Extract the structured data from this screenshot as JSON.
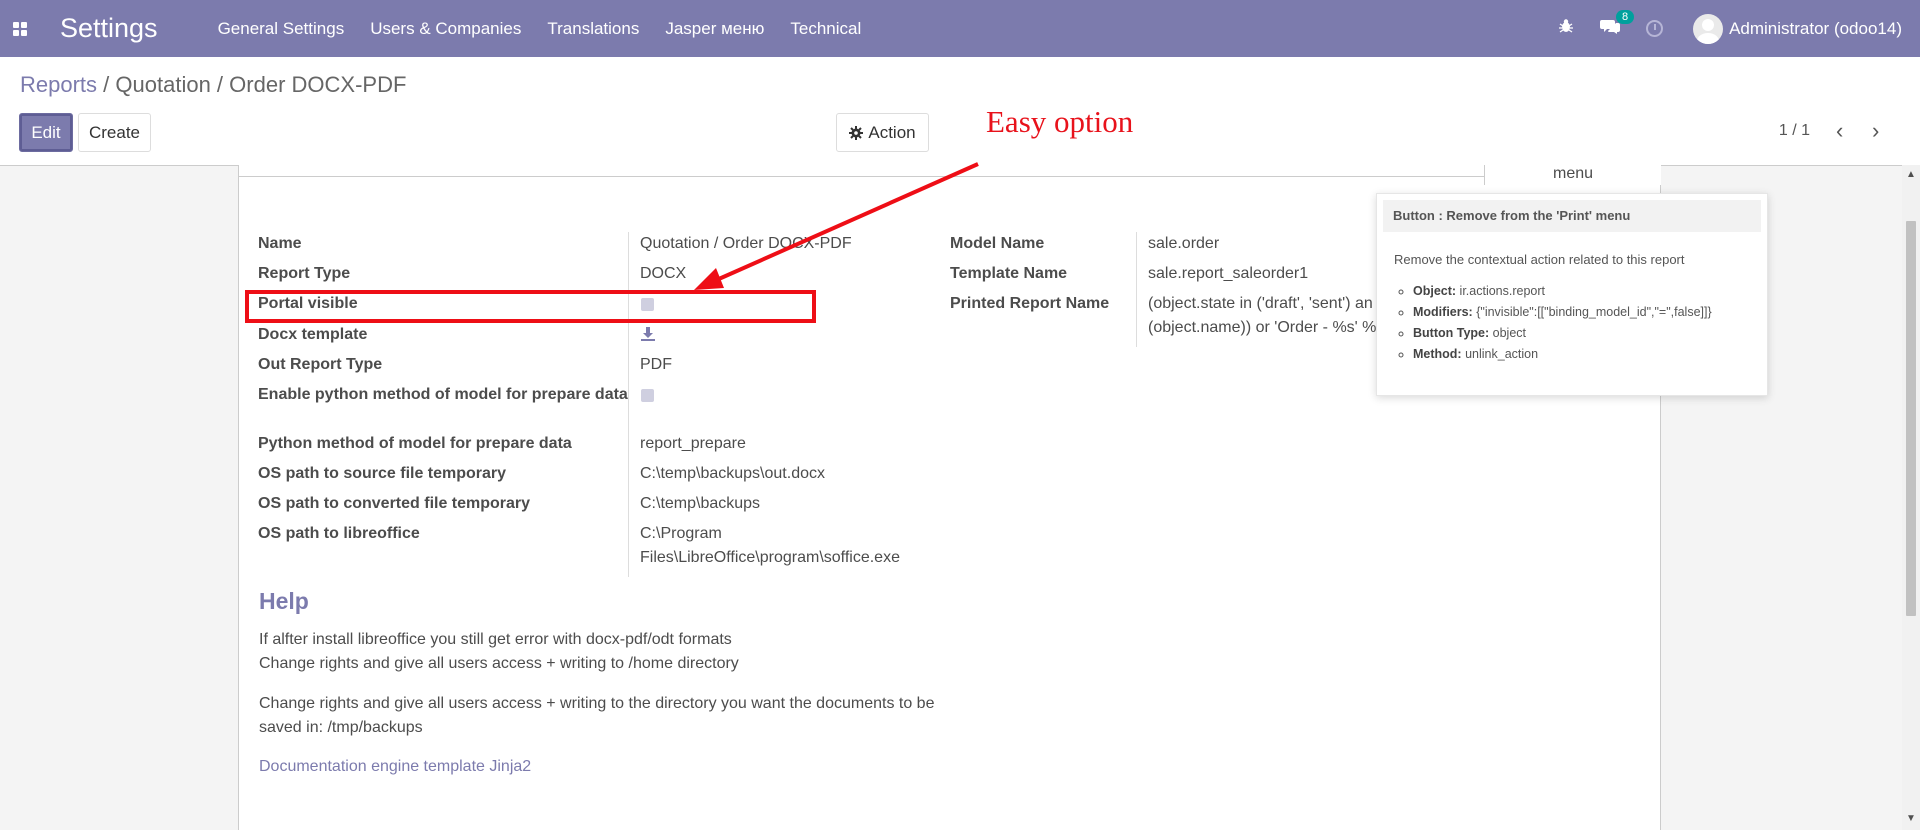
{
  "navbar": {
    "app_title": "Settings",
    "menus": [
      "General Settings",
      "Users & Companies",
      "Translations",
      "Jasper меню",
      "Technical"
    ],
    "messages_count": "8",
    "user": "Administrator (odoo14)"
  },
  "breadcrumb": {
    "parent": "Reports",
    "separator": "/",
    "current": "Quotation / Order DOCX-PDF"
  },
  "buttons": {
    "edit": "Edit",
    "create": "Create",
    "action": "Action"
  },
  "pager": "1 / 1",
  "annotation": "Easy option",
  "fields_left": [
    {
      "label": "Name",
      "value": "Quotation / Order DOCX-PDF"
    },
    {
      "label": "Report Type",
      "value": "DOCX"
    },
    {
      "label": "Portal visible",
      "value": ""
    },
    {
      "label": "Docx template",
      "value": ""
    },
    {
      "label": "Out Report Type",
      "value": "PDF"
    },
    {
      "label": "Enable python method of model for prepare data",
      "value": ""
    },
    {
      "label": "Python method of model for prepare data",
      "value": "report_prepare"
    },
    {
      "label": "OS path to source file temporary",
      "value": "C:\\temp\\backups\\out.docx"
    },
    {
      "label": "OS path to converted file temporary",
      "value": "C:\\temp\\backups"
    },
    {
      "label": "OS path to libreoffice",
      "value": "C:\\Program Files\\LibreOffice\\program\\soffice.exe"
    }
  ],
  "fields_right": [
    {
      "label": "Model Name",
      "value": "sale.order"
    },
    {
      "label": "Template Name",
      "value": "sale.report_saleorder1"
    },
    {
      "label": "Printed Report Name",
      "value": "(object.state in ('draft', 'sent') an (object.name)) or 'Order - %s' %"
    }
  ],
  "help": {
    "title": "Help",
    "line1": "If alfter install libreoffice you still get error with docx-pdf/odt formats",
    "line2": "Change rights and give all users access + writing to /home directory",
    "line3": "Change rights and give all users access + writing to the directory you want the documents to be saved in: /tmp/backups",
    "link": "Documentation engine template Jinja2"
  },
  "tooltip": {
    "tab_label": "menu",
    "title": "Button : Remove from the 'Print' menu",
    "description": "Remove the contextual action related to this report",
    "items": [
      {
        "key": "Object:",
        "value": "ir.actions.report"
      },
      {
        "key": "Modifiers:",
        "value": "{\"invisible\":[[\"binding_model_id\",\"=\",false]]}"
      },
      {
        "key": "Button Type:",
        "value": "object"
      },
      {
        "key": "Method:",
        "value": "unlink_action"
      }
    ]
  },
  "colors": {
    "brand": "#7c7bad",
    "annotation": "#ee0e16",
    "badge": "#00a09d"
  }
}
